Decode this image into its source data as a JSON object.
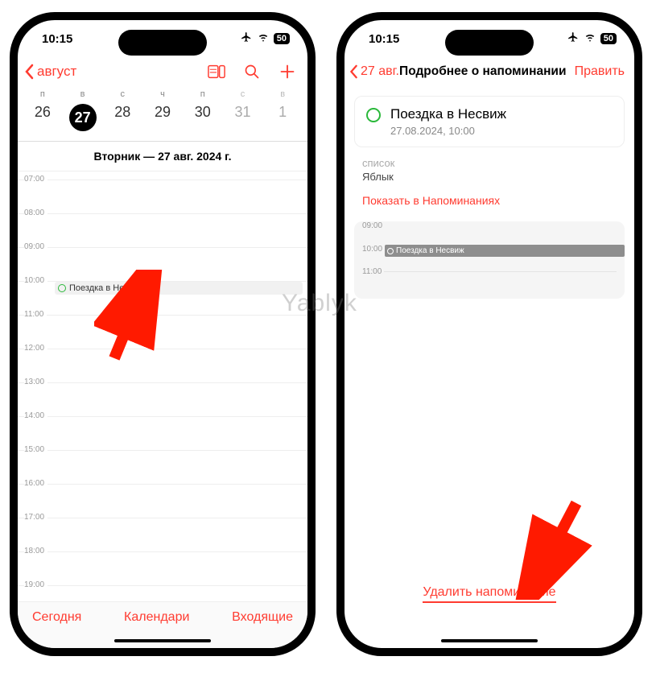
{
  "watermark": "Yablyk",
  "status": {
    "time": "10:15",
    "battery": "50"
  },
  "left": {
    "back_label": "август",
    "weekdays": [
      "п",
      "в",
      "с",
      "ч",
      "п",
      "с",
      "в"
    ],
    "dates": [
      "26",
      "27",
      "28",
      "29",
      "30",
      "31",
      "1"
    ],
    "selected_index": 1,
    "day_header": "Вторник — 27 авг. 2024 г.",
    "hours": [
      "07:00",
      "08:00",
      "09:00",
      "10:00",
      "11:00",
      "12:00",
      "13:00",
      "14:00",
      "15:00",
      "16:00",
      "17:00",
      "18:00",
      "19:00"
    ],
    "event_hour_index": 3,
    "event_title": "Поездка в Несвиж",
    "footer": {
      "today": "Сегодня",
      "calendars": "Календари",
      "inbox": "Входящие"
    }
  },
  "right": {
    "back_label": "27 авг.",
    "title": "Подробнее о напоминании",
    "edit": "Править",
    "reminder_title": "Поездка в Несвиж",
    "reminder_datetime": "27.08.2024, 10:00",
    "list_label": "список",
    "list_value": "Яблык",
    "show_in_reminders": "Показать в Напоминаниях",
    "mini_hours": [
      "09:00",
      "10:00",
      "11:00"
    ],
    "mini_event_title": "Поездка в Несвиж",
    "delete_label": "Удалить напоминание"
  }
}
